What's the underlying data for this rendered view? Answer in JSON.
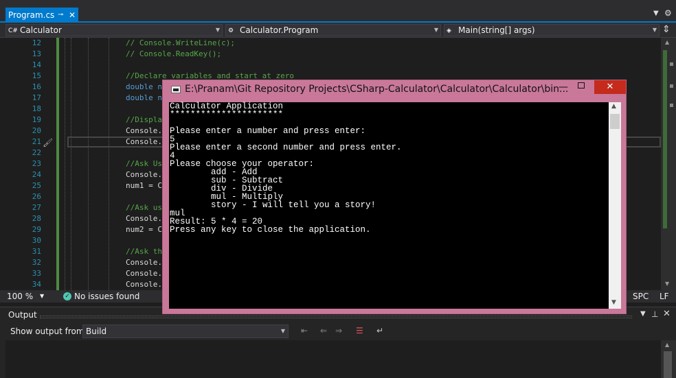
{
  "tab": {
    "filename": "Program.cs",
    "pin_glyph": "⊸",
    "close_glyph": "✕"
  },
  "navbar": {
    "project": "Calculator",
    "project_icon": "C#",
    "type": "Calculator.Program",
    "member": "Main(string[] args)"
  },
  "editor": {
    "lines": [
      {
        "num": "12",
        "text": "// Console.WriteLine(c);",
        "kind": "comment"
      },
      {
        "num": "13",
        "text": "// Console.ReadKey();",
        "kind": "comment"
      },
      {
        "num": "14",
        "text": "",
        "kind": "plain"
      },
      {
        "num": "15",
        "text": "//Declare variables and start at zero",
        "kind": "comment"
      },
      {
        "num": "16",
        "text": "double n",
        "kind": "kw"
      },
      {
        "num": "17",
        "text": "double n",
        "kind": "kw"
      },
      {
        "num": "18",
        "text": "",
        "kind": "plain"
      },
      {
        "num": "19",
        "text": "//Displa",
        "kind": "comment"
      },
      {
        "num": "20",
        "text": "Console.",
        "kind": "plain"
      },
      {
        "num": "21",
        "text": "Console.",
        "kind": "plain"
      },
      {
        "num": "22",
        "text": "",
        "kind": "plain"
      },
      {
        "num": "23",
        "text": "//Ask Us",
        "kind": "comment"
      },
      {
        "num": "24",
        "text": "Console.",
        "kind": "plain"
      },
      {
        "num": "25",
        "text": "num1 = C",
        "kind": "plain"
      },
      {
        "num": "26",
        "text": "",
        "kind": "plain"
      },
      {
        "num": "27",
        "text": "//Ask us",
        "kind": "comment"
      },
      {
        "num": "28",
        "text": "Console.",
        "kind": "plain"
      },
      {
        "num": "29",
        "text": "num2 = C",
        "kind": "plain"
      },
      {
        "num": "30",
        "text": "",
        "kind": "plain"
      },
      {
        "num": "31",
        "text": "//Ask th",
        "kind": "comment"
      },
      {
        "num": "32",
        "text": "Console.",
        "kind": "plain"
      },
      {
        "num": "33",
        "text": "Console.",
        "kind": "plain"
      },
      {
        "num": "34",
        "text": "Console.",
        "kind": "plain"
      }
    ]
  },
  "status": {
    "zoom": "100 %",
    "issues": "No issues found",
    "whitespace": "SPC",
    "line_ending": "LF"
  },
  "output": {
    "title": "Output",
    "show_from_label": "Show output from:",
    "show_from_value": "Build"
  },
  "console": {
    "title": "E:\\Pranam\\Git Repository Projects\\CSharp-Calculator\\Calculator\\Calculator\\bin...",
    "close_glyph": "✕",
    "min_glyph": "—",
    "output": "Calculator Application\n**********************\n\nPlease enter a number and press enter:\n5\nPlease enter a second number and press enter.\n4\nPlease choose your operator:\n        add - Add\n        sub - Subtract\n        div - Divide\n        mul - Multiply\n        story - I will tell you a story!\nmul\nResult: 5 * 4 = 20\nPress any key to close the application."
  },
  "colors": {
    "accent": "#007acc",
    "console_frame": "#c9789a",
    "comment": "#57a64a",
    "keyword": "#569cd6",
    "line_number": "#2b91af"
  }
}
